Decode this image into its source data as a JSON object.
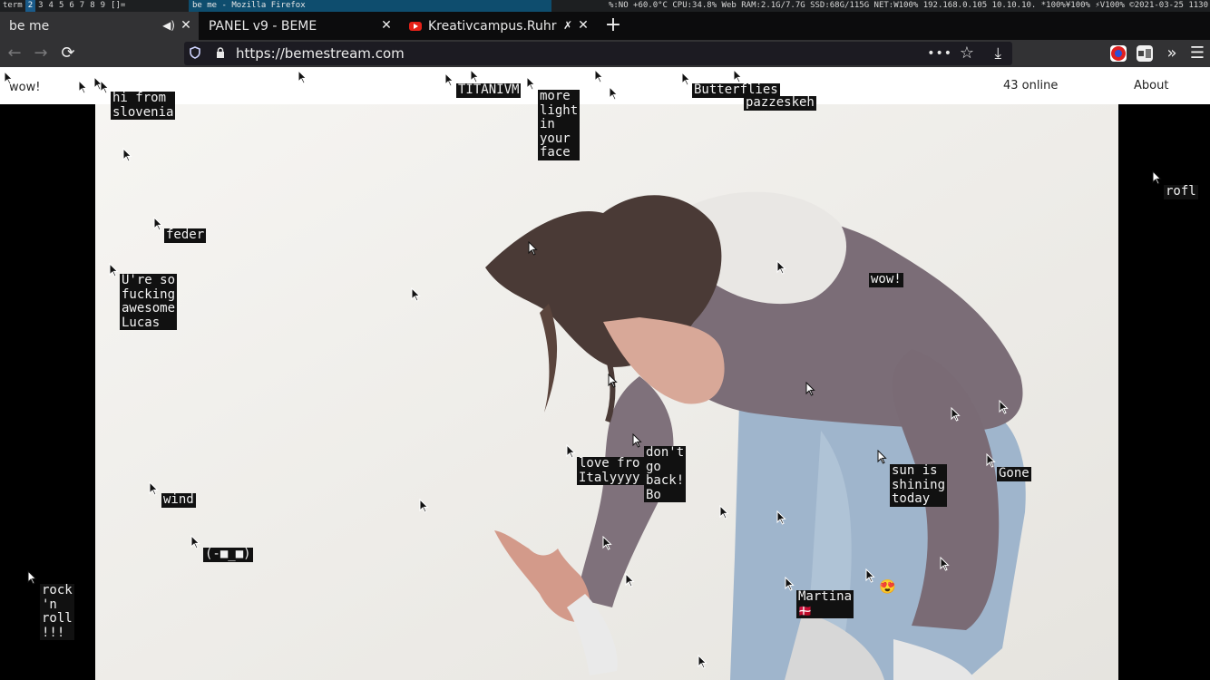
{
  "wm": {
    "left": "term",
    "workspaces": [
      "2",
      "3",
      "4",
      "5",
      "6",
      "7",
      "8",
      "9"
    ],
    "layout": "[]=",
    "window_title": "be me - Mozilla Firefox",
    "stats": "%:NO +60.0°C CPU:34.8% Web RAM:2.1G/7.7G SSD:68G/115G NET:W100% 192.168.0.105 10.10.10. *100%¥100% ⚡V100% ©2021-03-25 1130"
  },
  "tabs": [
    {
      "label": "be me",
      "active": true
    },
    {
      "label": "PANEL v9 - BEME",
      "active": false
    },
    {
      "label": "Kreativcampus.Ruhr – ",
      "active": false
    }
  ],
  "nav": {
    "url": "https://bemestream.com"
  },
  "site": {
    "brand": "wow!",
    "online": "43 online",
    "about": "About"
  },
  "chat_labels": [
    "hi from\nslovenia",
    "TITANIVM",
    "more\nlight\nin\nyour\nface",
    "Butterflies",
    "pazzeskeh",
    "rofl",
    "feder",
    "U're so\nfucking\nawesome\nLucas",
    "wow!",
    "love fro\nItalyyyy",
    "don't\ngo\nback!\nBo",
    "sun is\nshining\ntoday",
    "Gone",
    "wind",
    "(-■_■)",
    "rock\n'n\nroll\n!!!",
    "Martina",
    "🇩🇰",
    "😍"
  ],
  "colors": {
    "header_bg": "#ffffff",
    "video_bg": "#f2f1ee",
    "label_bg": "#111111",
    "firefox_tab_bg": "#323234"
  }
}
